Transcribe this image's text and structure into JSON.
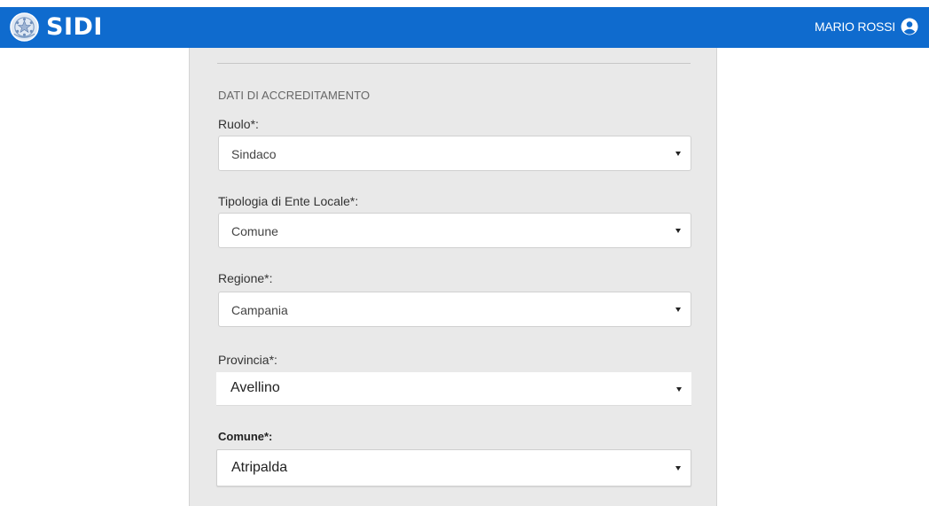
{
  "header": {
    "brand": "SIDI",
    "emblem_icon": "italian-republic-emblem-icon",
    "user_name": "MARIO ROSSI",
    "user_icon": "user-circle-icon",
    "bar_color": "#0f6bce"
  },
  "form": {
    "section_title": "DATI DI ACCREDITAMENTO",
    "fields": [
      {
        "label": "Ruolo*:",
        "value": "Sindaco"
      },
      {
        "label": "Tipologia di Ente Locale*:",
        "value": "Comune"
      },
      {
        "label": "Regione*:",
        "value": "Campania"
      },
      {
        "label": "Provincia*:",
        "value": "Avellino"
      },
      {
        "label": "Comune*:",
        "value": "Atripalda"
      }
    ],
    "dropdown_icon": "caret-down-icon"
  }
}
